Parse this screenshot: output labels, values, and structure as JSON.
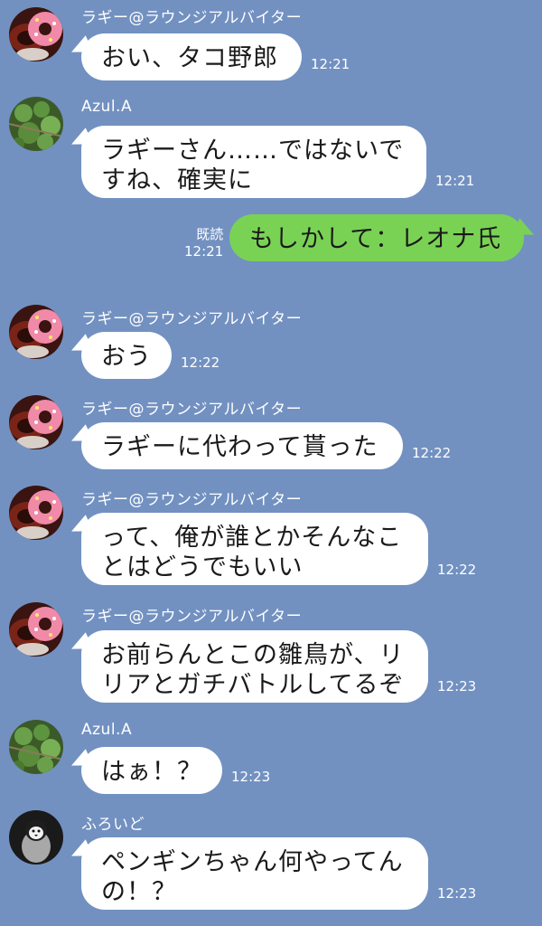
{
  "chat": {
    "messages": [
      {
        "sender": "ラギー@ラウンジアルバイター",
        "text": "おい、タコ野郎",
        "time": "12:21"
      },
      {
        "sender": "Azul.A",
        "text": "ラギーさん……ではないで\nすね、確実に",
        "time": "12:21"
      },
      {
        "read_label": "既読",
        "text": "もしかして：レオナ氏",
        "time": "12:21"
      },
      {
        "sender": "ラギー@ラウンジアルバイター",
        "text": "おう",
        "time": "12:22"
      },
      {
        "sender": "ラギー@ラウンジアルバイター",
        "text": "ラギーに代わって貰った",
        "time": "12:22"
      },
      {
        "sender": "ラギー@ラウンジアルバイター",
        "text": "って、俺が誰とかそんなこ\nとはどうでもいい",
        "time": "12:22"
      },
      {
        "sender": "ラギー@ラウンジアルバイター",
        "text": "お前らんとこの雛鳥が、リ\nリアとガチバトルしてるぞ",
        "time": "12:23"
      },
      {
        "sender": "Azul.A",
        "text": "はぁ！？",
        "time": "12:23"
      },
      {
        "sender": "ふろいど",
        "text": "ペンギンちゃん何やってん\nの！？",
        "time": "12:23"
      }
    ]
  },
  "avatars": {
    "ruggie": "donut-avatar-icon",
    "azul": "clover-avatar-icon",
    "floyd": "penguin-avatar-icon"
  },
  "colors": {
    "background": "#7291c1",
    "bubble_in": "#ffffff",
    "bubble_out": "#7ad255"
  }
}
